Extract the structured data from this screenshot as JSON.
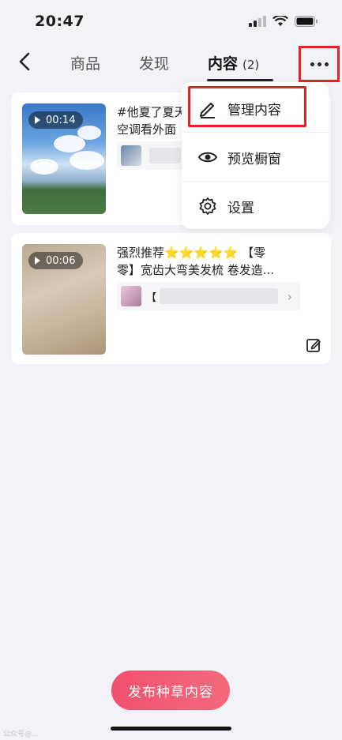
{
  "status_bar": {
    "time": "20:47"
  },
  "nav": {
    "tabs": [
      {
        "label": "商品"
      },
      {
        "label": "发现"
      },
      {
        "label": "内容",
        "count": "(2)"
      }
    ]
  },
  "menu": {
    "items": [
      {
        "label": "管理内容",
        "icon": "pencil-icon"
      },
      {
        "label": "预览橱窗",
        "icon": "eye-icon"
      },
      {
        "label": "设置",
        "icon": "gear-icon"
      }
    ]
  },
  "content_list": [
    {
      "duration": "00:14",
      "title_line1": "#他夏了夏天",
      "title_line2": "空调看外面"
    },
    {
      "duration": "00:06",
      "title_line1": "强烈推荐⭐⭐⭐⭐⭐ 【零",
      "title_line2": "零】宽齿大弯美发梳 卷发造...",
      "product_prefix": "【"
    }
  ],
  "publish_button": {
    "label": "发布种草内容"
  },
  "watermark": {
    "text": "公众号@..."
  },
  "colors": {
    "accent": "#f0506e",
    "highlight": "#e8231f"
  }
}
